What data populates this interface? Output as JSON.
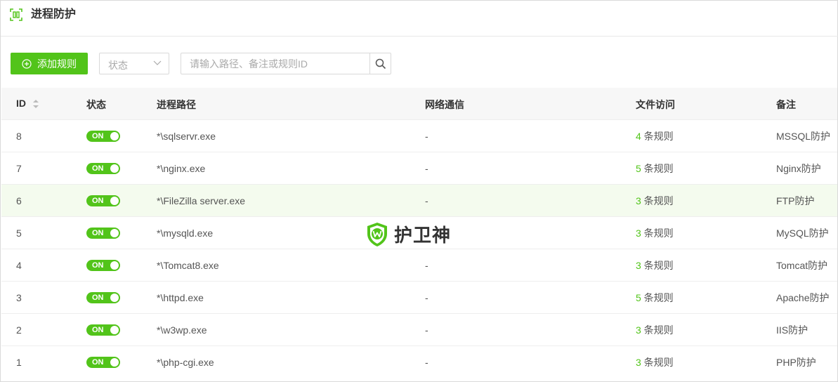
{
  "header": {
    "title": "进程防护",
    "icon": "process-shield-icon"
  },
  "toolbar": {
    "add_label": "添加规则",
    "status_select": {
      "selected": "状态"
    },
    "search": {
      "placeholder": "请输入路径、备注或规则ID",
      "value": ""
    }
  },
  "table": {
    "columns": [
      "ID",
      "状态",
      "进程路径",
      "网络通信",
      "文件访问",
      "备注"
    ],
    "rows": [
      {
        "id": "8",
        "status": "ON",
        "path": "*\\sqlservr.exe",
        "network": "-",
        "file_count": "4",
        "file_suffix": " 条规则",
        "note": "MSSQL防护"
      },
      {
        "id": "7",
        "status": "ON",
        "path": "*\\nginx.exe",
        "network": "-",
        "file_count": "5",
        "file_suffix": " 条规则",
        "note": "Nginx防护"
      },
      {
        "id": "6",
        "status": "ON",
        "path": "*\\FileZilla server.exe",
        "network": "-",
        "file_count": "3",
        "file_suffix": " 条规则",
        "note": "FTP防护"
      },
      {
        "id": "5",
        "status": "ON",
        "path": "*\\mysqld.exe",
        "network": "",
        "file_count": "3",
        "file_suffix": " 条规则",
        "note": "MySQL防护"
      },
      {
        "id": "4",
        "status": "ON",
        "path": "*\\Tomcat8.exe",
        "network": "-",
        "file_count": "3",
        "file_suffix": " 条规则",
        "note": "Tomcat防护"
      },
      {
        "id": "3",
        "status": "ON",
        "path": "*\\httpd.exe",
        "network": "-",
        "file_count": "5",
        "file_suffix": " 条规则",
        "note": "Apache防护"
      },
      {
        "id": "2",
        "status": "ON",
        "path": "*\\w3wp.exe",
        "network": "-",
        "file_count": "3",
        "file_suffix": " 条规则",
        "note": "IIS防护"
      },
      {
        "id": "1",
        "status": "ON",
        "path": "*\\php-cgi.exe",
        "network": "-",
        "file_count": "3",
        "file_suffix": " 条规则",
        "note": "PHP防护"
      }
    ]
  },
  "watermark": {
    "text": "护卫神",
    "icon": "shield-w-logo-icon"
  },
  "colors": {
    "accent": "#52c41a",
    "highlight_row": "#f4fbee",
    "border": "#d9d9d9"
  }
}
